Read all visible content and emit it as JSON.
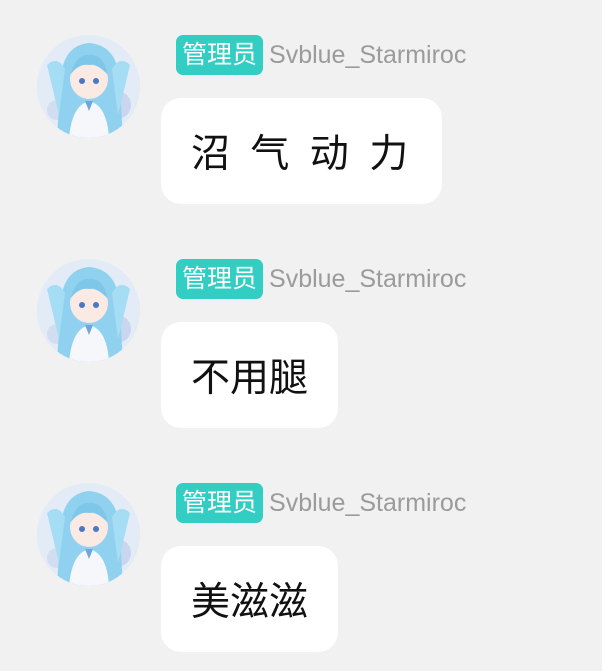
{
  "colors": {
    "background": "#f1f1f1",
    "badge": "#32cdc3",
    "username": "#9b9b9b",
    "bubble": "#ffffff"
  },
  "messages": [
    {
      "badge": "管理员",
      "username": "Svblue_Starmiroc",
      "text": "沼 气 动 力",
      "avatar_icon": "anime-girl-avatar"
    },
    {
      "badge": "管理员",
      "username": "Svblue_Starmiroc",
      "text": "不用腿",
      "avatar_icon": "anime-girl-avatar"
    },
    {
      "badge": "管理员",
      "username": "Svblue_Starmiroc",
      "text": "美滋滋",
      "avatar_icon": "anime-girl-avatar"
    }
  ]
}
